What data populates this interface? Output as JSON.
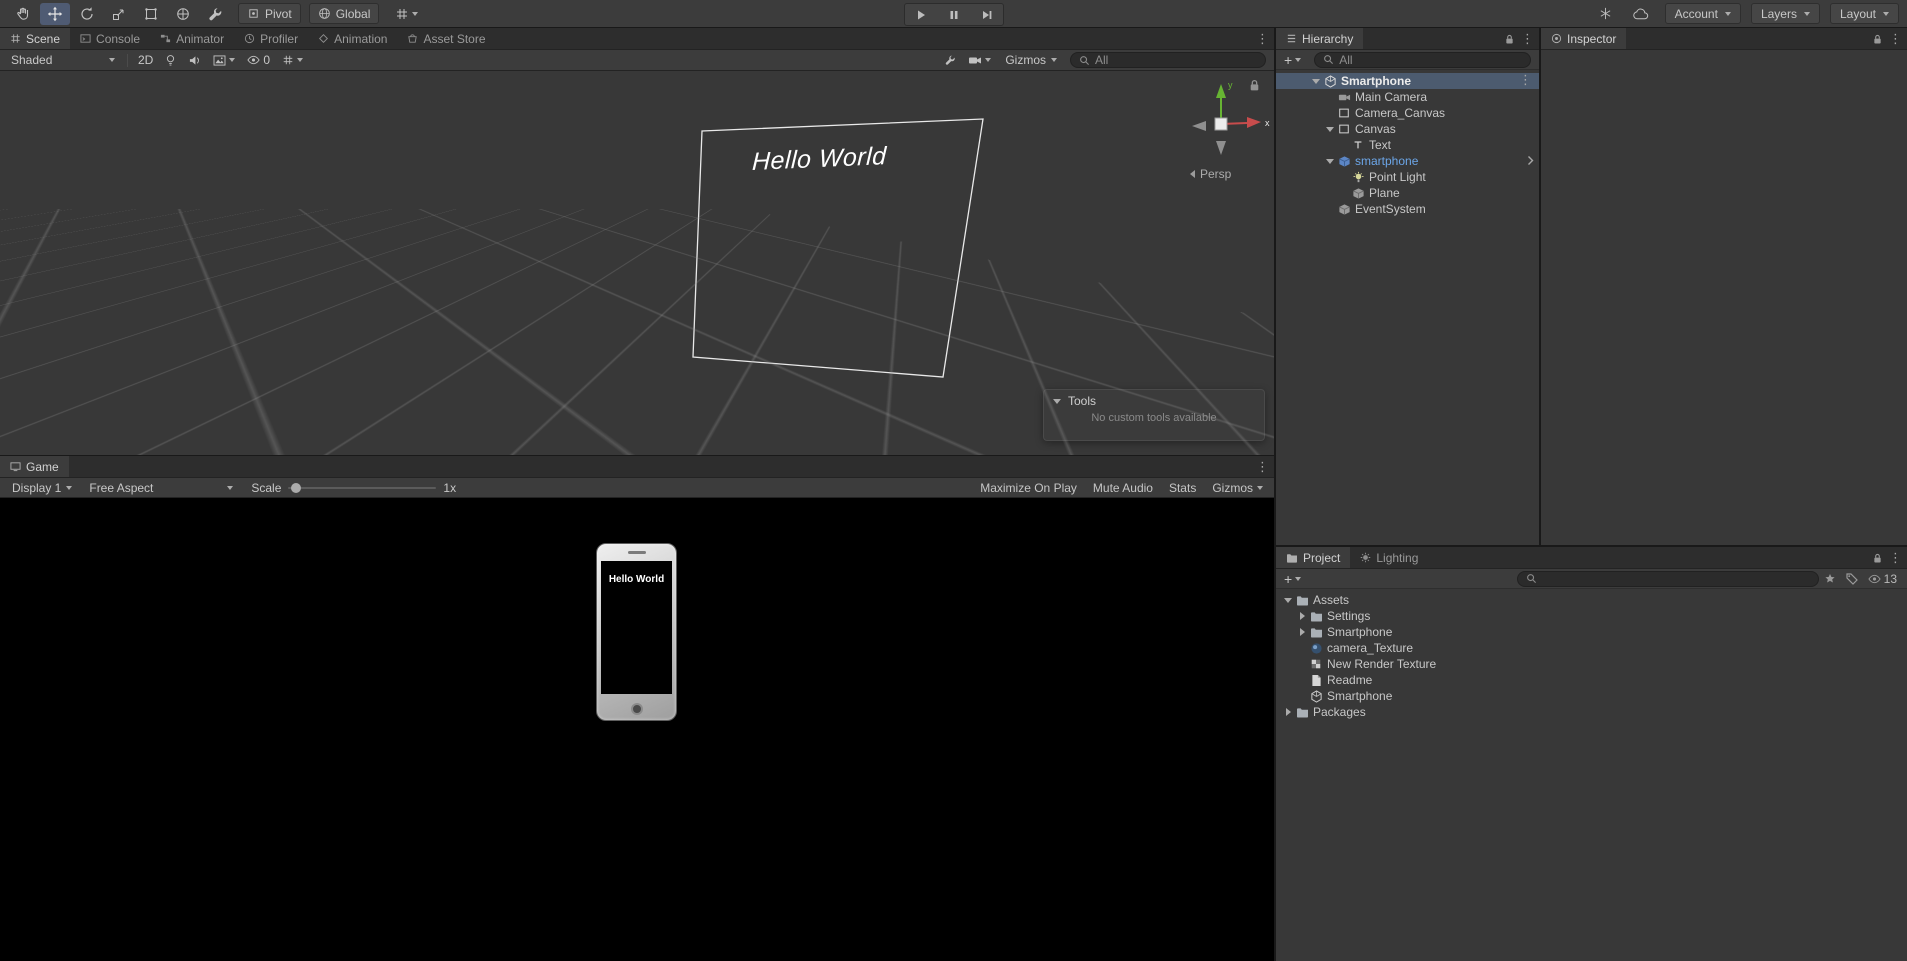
{
  "toolbar": {
    "pivot": "Pivot",
    "global": "Global",
    "account": "Account",
    "layers": "Layers",
    "layout": "Layout"
  },
  "scene": {
    "tabs": [
      "Scene",
      "Console",
      "Animator",
      "Profiler",
      "Animation",
      "Asset Store"
    ],
    "shading": "Shaded",
    "two_d": "2D",
    "hidden_count": "0",
    "gizmos": "Gizmos",
    "search": "All",
    "hello": "Hello World",
    "persp": "Persp",
    "axis_x": "x",
    "axis_y": "y",
    "tools_title": "Tools",
    "tools_message": "No custom tools available"
  },
  "game": {
    "tab": "Game",
    "display": "Display 1",
    "aspect": "Free Aspect",
    "scale_label": "Scale",
    "scale_value": "1x",
    "maximize": "Maximize On Play",
    "mute": "Mute Audio",
    "stats": "Stats",
    "gizmos": "Gizmos",
    "screen_text": "Hello World"
  },
  "hierarchy": {
    "tab": "Hierarchy",
    "search": "All",
    "items": [
      {
        "label": "Smartphone",
        "type": "scene"
      },
      {
        "label": "Main Camera",
        "type": "camera"
      },
      {
        "label": "Camera_Canvas",
        "type": "canvas"
      },
      {
        "label": "Canvas",
        "type": "canvas"
      },
      {
        "label": "Text",
        "type": "text"
      },
      {
        "label": "smartphone",
        "type": "prefab"
      },
      {
        "label": "Point Light",
        "type": "light"
      },
      {
        "label": "Plane",
        "type": "gameobject"
      },
      {
        "label": "EventSystem",
        "type": "gameobject"
      }
    ]
  },
  "inspector": {
    "tab": "Inspector"
  },
  "project": {
    "tab_project": "Project",
    "tab_lighting": "Lighting",
    "visible_count": "13",
    "items": [
      {
        "label": "Assets",
        "type": "folder"
      },
      {
        "label": "Settings",
        "type": "folder"
      },
      {
        "label": "Smartphone",
        "type": "folder"
      },
      {
        "label": "camera_Texture",
        "type": "render-texture"
      },
      {
        "label": "New Render Texture",
        "type": "checker-texture"
      },
      {
        "label": "Readme",
        "type": "asset"
      },
      {
        "label": "Smartphone",
        "type": "unity-asset"
      },
      {
        "label": "Packages",
        "type": "folder"
      }
    ]
  },
  "colors": {
    "selection": "#4C5B6F",
    "prefab_text": "#6CA6E8",
    "axis_x": "#C84C4C",
    "axis_y": "#67B433"
  }
}
